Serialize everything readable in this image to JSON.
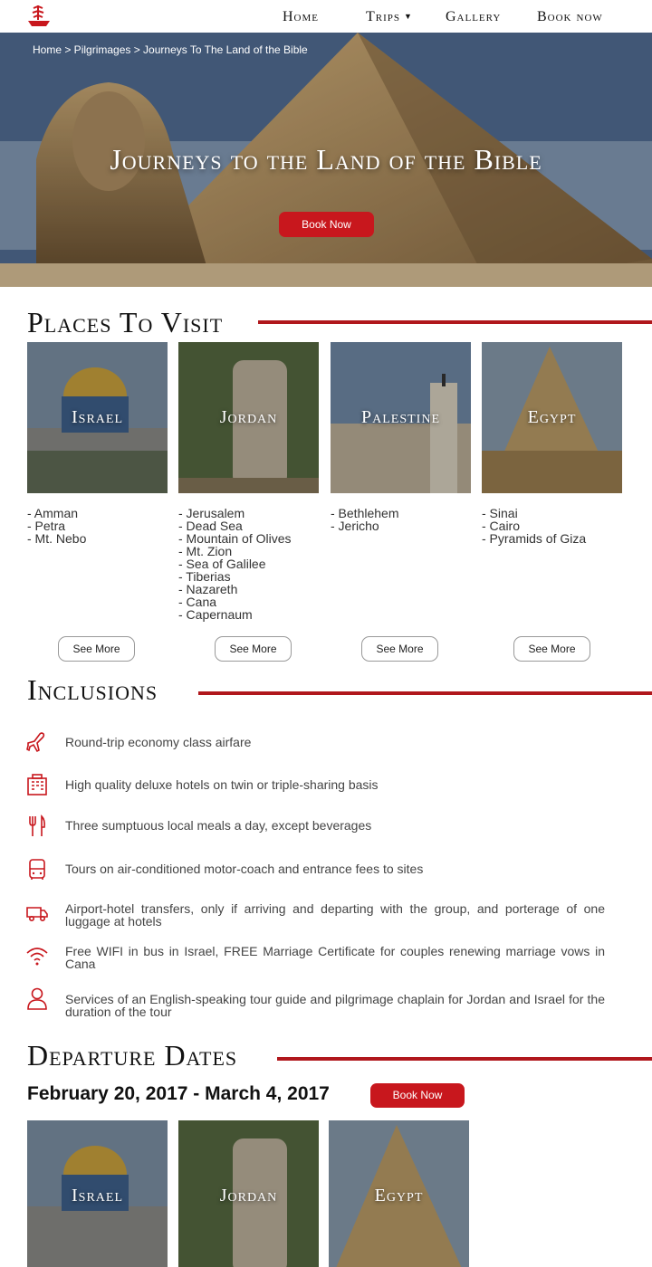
{
  "nav": {
    "items": [
      {
        "label": "Home"
      },
      {
        "label": "Trips"
      },
      {
        "label": "Gallery"
      },
      {
        "label": "Book now"
      }
    ]
  },
  "hero": {
    "breadcrumb": "Home > Pilgrimages > Journeys To The Land of the Bible",
    "title": "Journeys to the Land of the Bible",
    "button": "Book Now"
  },
  "places": {
    "title": "Places To Visit",
    "cards": [
      {
        "name": "Israel",
        "sites": [
          "- Amman",
          "- Petra",
          "- Mt. Nebo"
        ],
        "button": "See More"
      },
      {
        "name": "Jordan",
        "sites": [
          "- Jerusalem",
          "- Dead Sea",
          "- Mountain of Olives",
          "- Mt. Zion",
          "- Sea of Galilee",
          "- Tiberias",
          "- Nazareth",
          "- Cana",
          "- Capernaum"
        ],
        "button": "See More"
      },
      {
        "name": "Palestine",
        "sites": [
          "- Bethlehem",
          "- Jericho"
        ],
        "button": "See More"
      },
      {
        "name": "Egypt",
        "sites": [
          "- Sinai",
          "- Cairo",
          "- Pyramids of Giza"
        ],
        "button": "See More"
      }
    ]
  },
  "inclusions": {
    "title": "Inclusions",
    "items": [
      {
        "icon": "airplane-icon",
        "text": "Round-trip economy class airfare"
      },
      {
        "icon": "hotel-icon",
        "text": "High quality deluxe hotels on twin or triple-sharing basis"
      },
      {
        "icon": "utensils-icon",
        "text": "Three sumptuous local meals a day, except beverages"
      },
      {
        "icon": "bus-icon",
        "text": "Tours on air-conditioned motor-coach and entrance fees to sites"
      },
      {
        "icon": "truck-icon",
        "text": "Airport-hotel transfers, only if arriving and departing with the group, and porterage of one luggage at hotels"
      },
      {
        "icon": "wifi-icon",
        "text": "Free WIFI in bus in Israel, FREE Marriage Certificate for couples renewing marriage vows in Cana"
      },
      {
        "icon": "person-icon",
        "text": "Services of an English-speaking tour guide and pilgrimage chaplain for Jordan and Israel for the duration of the tour"
      }
    ]
  },
  "departure": {
    "title": "Departure Dates",
    "date": "February 20, 2017 - March 4, 2017",
    "button": "Book Now",
    "cards": [
      {
        "name": "Israel"
      },
      {
        "name": "Jordan"
      },
      {
        "name": "Egypt"
      }
    ]
  },
  "colors": {
    "accent": "#c8171d",
    "rule": "#b0171c"
  }
}
